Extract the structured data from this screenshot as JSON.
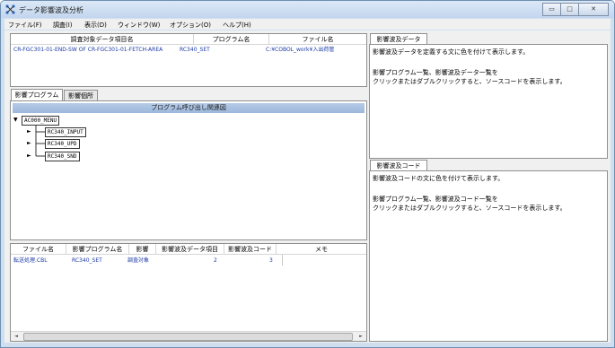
{
  "window": {
    "title": "データ影響波及分析",
    "btn_min": "▭",
    "btn_max": "□",
    "btn_close": "✕"
  },
  "menu": [
    "ファイル(F)",
    "調査(I)",
    "表示(D)",
    "ウィンドウ(W)",
    "オプション(O)",
    "ヘルプ(H)"
  ],
  "top_table": {
    "headers": [
      "調査対象データ項目名",
      "プログラム名",
      "ファイル名"
    ],
    "row": [
      "CR-FGC301-01-END-SW OF CR-FGC301-01-FETCH-AREA",
      "RC340_SET",
      "C:¥COBOL_work¥入出荷管"
    ]
  },
  "left_tabs": [
    "影響プログラム",
    "影響個所"
  ],
  "call_graph": {
    "title": "プログラム呼び出し関連図",
    "root": "AC000_MENU",
    "children": [
      "RC340_INPUT",
      "RC340_UPD",
      "RC340_SND"
    ]
  },
  "bottom_table": {
    "headers": [
      "ファイル名",
      "影響プログラム名",
      "影響",
      "影響波及データ項目",
      "影響波及コード",
      "メモ"
    ],
    "row": [
      "転送処理.CBL",
      "RC340_SET",
      "調査対象",
      "2",
      "3",
      ""
    ]
  },
  "data_panel": {
    "tab": "影響波及データ",
    "line1": "影響波及データを定義する文に色を付けて表示します。",
    "line2": "影響プログラム一覧、影響波及データ一覧を",
    "line3": "クリックまたはダブルクリックすると、ソースコードを表示します。"
  },
  "code_panel": {
    "tab": "影響波及コード",
    "line1": "影響波及コードの文に色を付けて表示します。",
    "line2": "影響プログラム一覧、影響波及コード一覧を",
    "line3": "クリックまたはダブルクリックすると、ソースコードを表示します。"
  },
  "scroll": {
    "left": "◄",
    "right": "►"
  }
}
